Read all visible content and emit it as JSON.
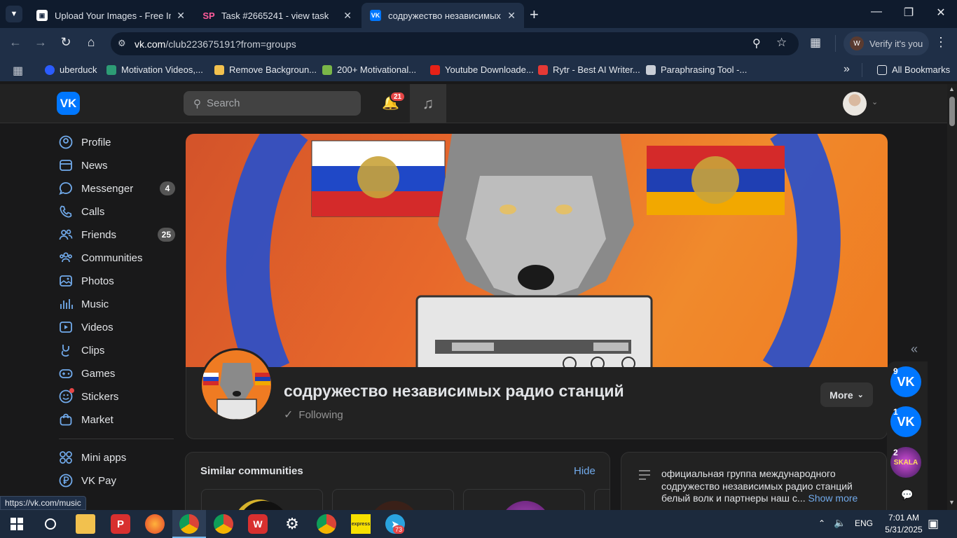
{
  "browser": {
    "tabs": [
      {
        "title": "Upload Your Images - Free Imag",
        "icon": "image-upload-favicon",
        "active": false
      },
      {
        "title": "Task #2665241 - view task",
        "icon": "sp-favicon",
        "active": false
      },
      {
        "title": "содружество независимых ра,",
        "icon": "vk-favicon",
        "active": true
      }
    ],
    "url_host": "vk.com",
    "url_path": "/club223675191?from=groups",
    "profile_button": "Verify it's you",
    "bookmarks": [
      "uberduck",
      "Motivation Videos,...",
      "Remove Backgroun...",
      "200+ Motivational...",
      "Youtube Downloade...",
      "Rytr - Best AI Writer...",
      "Paraphrasing Tool -..."
    ],
    "all_bookmarks": "All Bookmarks",
    "status_url": "https://vk.com/music"
  },
  "vk": {
    "logo": "VK",
    "search_placeholder": "Search",
    "notifications_count": "21",
    "menu": [
      {
        "label": "Profile",
        "icon": "profile-icon"
      },
      {
        "label": "News",
        "icon": "news-icon"
      },
      {
        "label": "Messenger",
        "icon": "messenger-icon",
        "badge": "4"
      },
      {
        "label": "Calls",
        "icon": "calls-icon"
      },
      {
        "label": "Friends",
        "icon": "friends-icon",
        "badge": "25"
      },
      {
        "label": "Communities",
        "icon": "communities-icon"
      },
      {
        "label": "Photos",
        "icon": "photos-icon"
      },
      {
        "label": "Music",
        "icon": "music-icon"
      },
      {
        "label": "Videos",
        "icon": "videos-icon"
      },
      {
        "label": "Clips",
        "icon": "clips-icon"
      },
      {
        "label": "Games",
        "icon": "games-icon"
      },
      {
        "label": "Stickers",
        "icon": "stickers-icon"
      },
      {
        "label": "Market",
        "icon": "market-icon"
      }
    ],
    "menu_extra": [
      {
        "label": "Mini apps",
        "icon": "mini-apps-icon"
      },
      {
        "label": "VK Pay",
        "icon": "vk-pay-icon"
      }
    ],
    "group": {
      "title": "содружество независимых радио станций",
      "following": "Following",
      "more": "More"
    },
    "similar": {
      "title": "Similar communities",
      "hide": "Hide"
    },
    "about": {
      "text": "официальная группа международного содружество независимых радио станций белый волк и партнеры наш с...",
      "show_more": "Show more"
    },
    "rail_counts": [
      "9",
      "1",
      "2"
    ],
    "rail_third_label": "SKALA"
  },
  "taskbar": {
    "lang": "ENG",
    "time": "7:01 AM",
    "date": "5/31/2025",
    "telegram_badge": "73"
  },
  "colors": {
    "vk_blue": "#0077ff",
    "link_blue": "#71aaeb",
    "notification_red": "#e64646"
  }
}
